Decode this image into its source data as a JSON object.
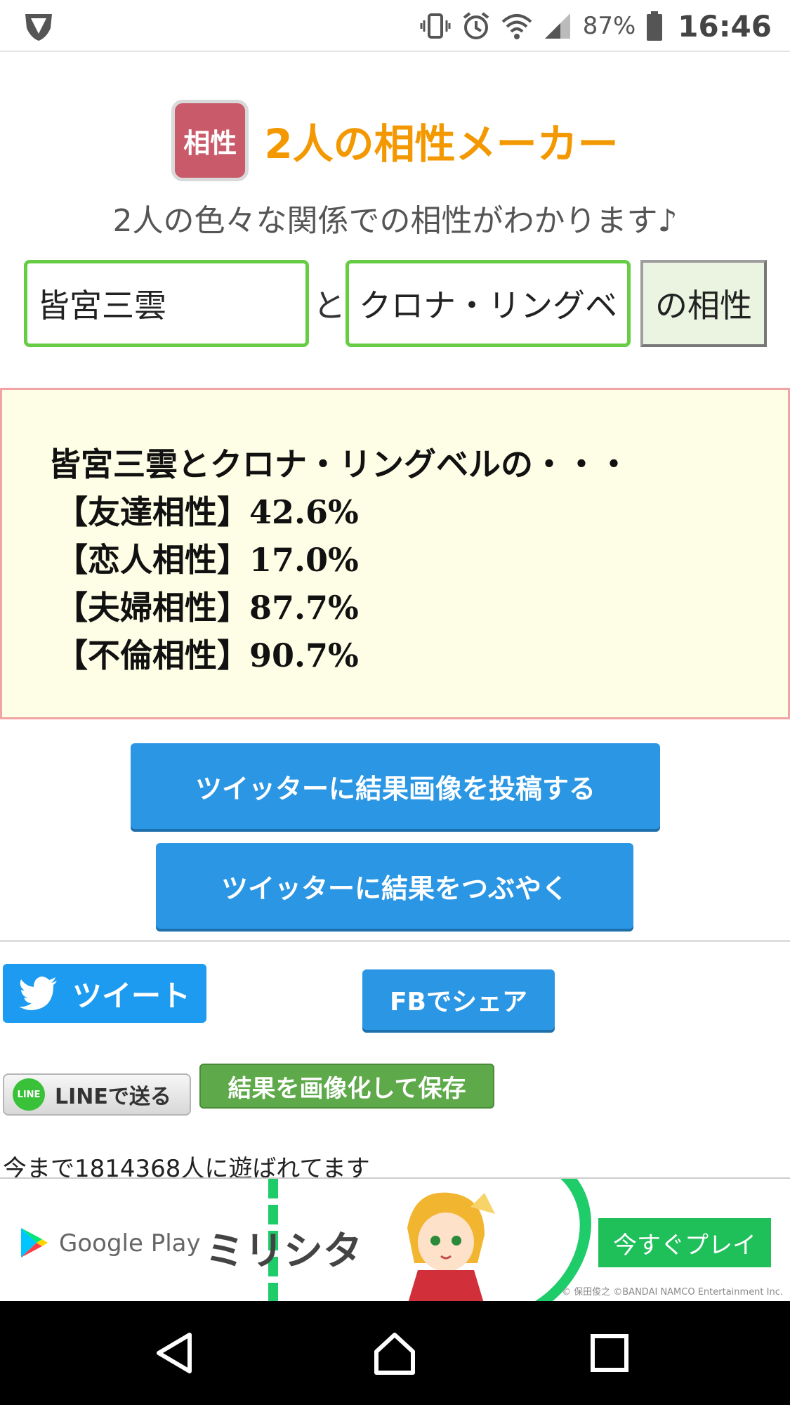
{
  "status_bar": {
    "battery_percent": "87%",
    "time": "16:46"
  },
  "header": {
    "logo_text": "相性",
    "title": "2人の相性メーカー",
    "subtitle": "2人の色々な関係での相性がわかります♪"
  },
  "form": {
    "name1": "皆宮三雲",
    "connector": "と",
    "name2": "クロナ・リングベ",
    "submit_label": "の相性"
  },
  "result": {
    "heading": "皆宮三雲とクロナ・リングベルの・・・",
    "items": [
      {
        "label": "【友達相性】",
        "value": "42.6%"
      },
      {
        "label": "【恋人相性】",
        "value": "17.0%"
      },
      {
        "label": "【夫婦相性】",
        "value": "87.7%"
      },
      {
        "label": "【不倫相性】",
        "value": "90.7%"
      }
    ]
  },
  "actions": {
    "tweet_image_label": "ツイッターに結果画像を投稿する",
    "tweet_text_label": "ツイッターに結果をつぶやく",
    "tweet_label": "ツイート",
    "fb_label": "FBでシェア",
    "line_label": "LINEで送る",
    "line_logo_text": "LINE",
    "save_image_label": "結果を画像化して保存"
  },
  "play_count_text": "今まで1814368人に遊ばれてます",
  "ad": {
    "store_text": "Google Play",
    "game_title": "ミリシタ",
    "cta_label": "今すぐプレイ",
    "copyright": "© 保田俊之 ©BANDAI NAMCO Entertainment Inc."
  },
  "colors": {
    "title_orange": "#f39800",
    "input_border_green": "#66cc44",
    "result_bg": "#fefee6",
    "result_border": "#f2a3a3",
    "twitter_blue": "#2a96e4",
    "save_green": "#5ea94a"
  }
}
